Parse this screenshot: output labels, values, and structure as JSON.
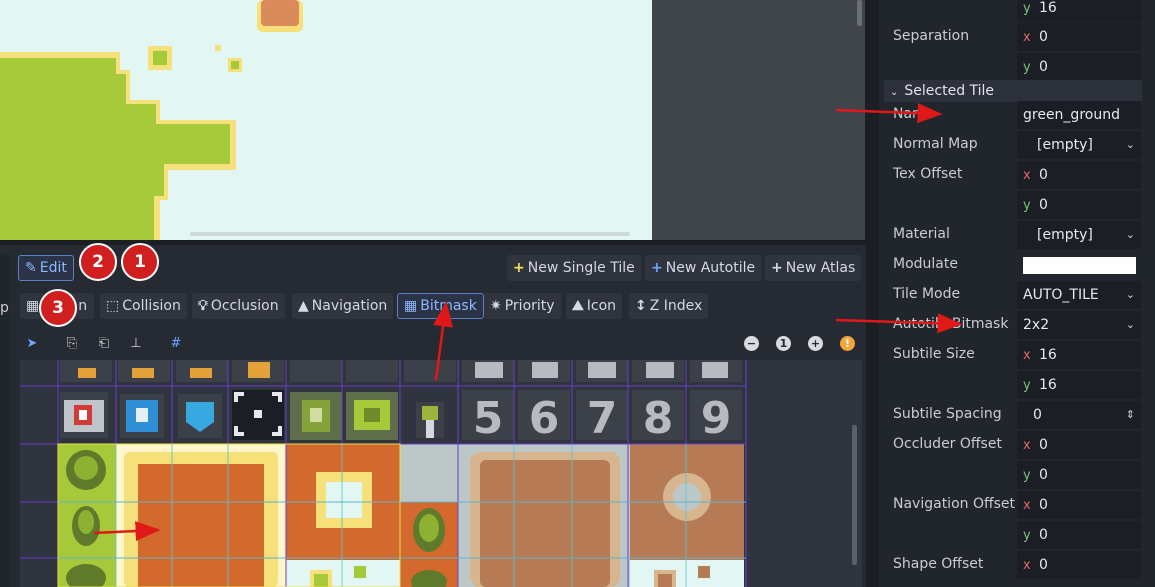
{
  "toolbar": {
    "edit_label": "Edit",
    "new_single_tile": "New Single Tile",
    "new_autotile": "New Autotile",
    "new_atlas": "New Atlas"
  },
  "mode_tabs": [
    {
      "label": "n",
      "icon": "region-icon"
    },
    {
      "label": "Collision",
      "icon": "collision-icon"
    },
    {
      "label": "Occlusion",
      "icon": "occlusion-icon"
    },
    {
      "label": "Navigation",
      "icon": "navigation-icon"
    },
    {
      "label": "Bitmask",
      "icon": "bitmask-icon",
      "active": true
    },
    {
      "label": "Priority",
      "icon": "priority-icon"
    },
    {
      "label": "Icon",
      "icon": "icon-icon"
    },
    {
      "label": "Z Index",
      "icon": "zindex-icon"
    }
  ],
  "annotations": {
    "badge1": "1",
    "badge2": "2",
    "badge3": "3"
  },
  "left_cut_text": "p",
  "atlas_digits": [
    "5",
    "6",
    "7",
    "8",
    "9"
  ],
  "zoom_reset_label": "1",
  "inspector": {
    "top_y_value": "16",
    "separation": {
      "label": "Separation",
      "x": "0",
      "y": "0"
    },
    "section": "Selected Tile",
    "name": {
      "label": "Name",
      "value": "green_ground"
    },
    "normal_map": {
      "label": "Normal Map",
      "value": "[empty]"
    },
    "tex_offset": {
      "label": "Tex Offset",
      "x": "0",
      "y": "0"
    },
    "material": {
      "label": "Material",
      "value": "[empty]"
    },
    "modulate": {
      "label": "Modulate",
      "color": "#ffffff"
    },
    "tile_mode": {
      "label": "Tile Mode",
      "value": "AUTO_TILE"
    },
    "autotile_bitmask": {
      "label": "Autotile Bitmask",
      "value": "2x2"
    },
    "subtile_size": {
      "label": "Subtile Size",
      "x": "16",
      "y": "16"
    },
    "subtile_spacing": {
      "label": "Subtile Spacing",
      "value": "0"
    },
    "occluder_offset": {
      "label": "Occluder Offset",
      "x": "0",
      "y": "0"
    },
    "navigation_offset": {
      "label": "Navigation Offset",
      "x": "0",
      "y": "0"
    },
    "shape_offset": {
      "label": "Shape Offset",
      "x": "0"
    },
    "axis_x": "x",
    "axis_y": "y"
  },
  "colors": {
    "accent": "#5a80c8",
    "annotation_red": "#d11f1f",
    "grass": "#a3c83a",
    "dirt": "#d4692e"
  }
}
